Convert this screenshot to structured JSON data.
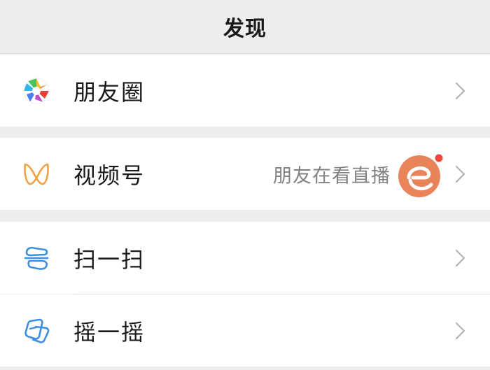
{
  "header": {
    "title": "发现"
  },
  "items": [
    {
      "label": "朋友圈",
      "icon": "moments-aperture-icon"
    },
    {
      "label": "视频号",
      "icon": "channels-icon",
      "subtitle": "朋友在看直播"
    },
    {
      "label": "扫一扫",
      "icon": "scan-icon"
    },
    {
      "label": "摇一摇",
      "icon": "shake-icon"
    }
  ],
  "colors": {
    "background": "#ededed",
    "cell": "#ffffff",
    "text": "#191919",
    "subtext": "#808080",
    "chevron": "#b2b2b2",
    "channels_orange": "#f0a047",
    "scan_blue": "#3d8fe0",
    "live_dot": "#f4473b",
    "avatar_orange": "#e8835a"
  }
}
